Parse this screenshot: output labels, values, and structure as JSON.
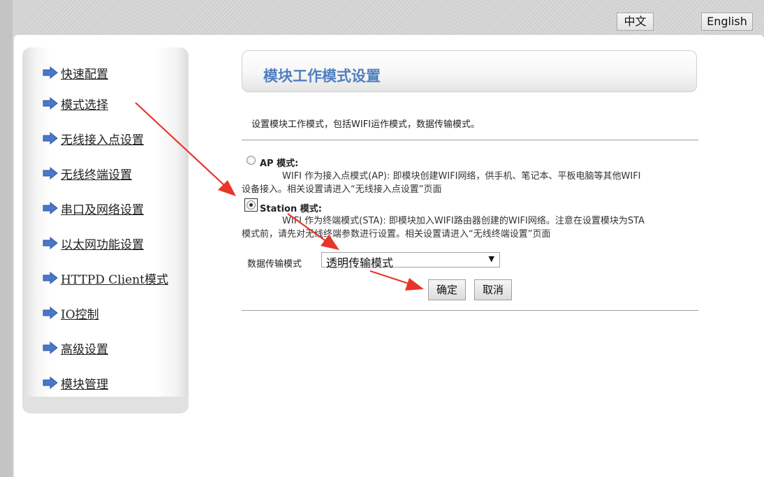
{
  "header": {
    "lang_zh": "中文",
    "lang_en": "English"
  },
  "sidebar": {
    "items": [
      {
        "label": "快速配置"
      },
      {
        "label": "模式选择"
      },
      {
        "label": "无线接入点设置"
      },
      {
        "label": "无线终端设置"
      },
      {
        "label": "串口及网络设置"
      },
      {
        "label": "以太网功能设置"
      },
      {
        "label": "HTTPD Client模式"
      },
      {
        "label": "IO控制"
      },
      {
        "label": "高级设置"
      },
      {
        "label": "模块管理"
      }
    ],
    "icon": "right-arrow-icon"
  },
  "main": {
    "title": "模块工作模式设置",
    "description": "设置模块工作模式，包括WIFI运作模式，数据传输模式。",
    "modes": [
      {
        "label": "AP 模式:",
        "desc_line1": "WIFI 作为接入点模式(AP): 即模块创建WIFI网络，供手机、笔记本、平板电脑等其他WIFI",
        "desc_line2": "设备接入。相关设置请进入“无线接入点设置”页面",
        "checked": false
      },
      {
        "label": "Station 模式:",
        "desc_line1": "WIFI 作为终端模式(STA): 即模块加入WIFI路由器创建的WIFI网络。注意在设置模块为STA",
        "desc_line2": "模式前，请先对无线终端参数进行设置。相关设置请进入“无线终端设置”页面",
        "checked": true
      }
    ],
    "transfer_mode_label": "数据传输模式",
    "transfer_mode_value": "透明传输模式",
    "confirm_label": "确定",
    "cancel_label": "取消"
  },
  "colors": {
    "title": "#4f7fc0",
    "annotation_arrow": "#e8352a",
    "menu_arrow": "#4a78c8"
  }
}
